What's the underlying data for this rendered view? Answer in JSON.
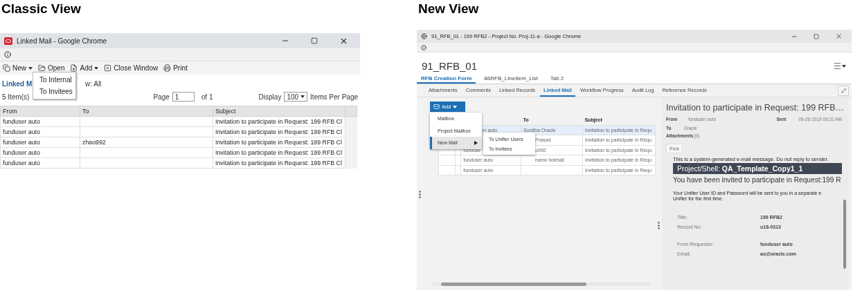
{
  "classic": {
    "heading": "Classic View",
    "window_title": "Linked Mail - Google Chrome",
    "toolbar": [
      {
        "label": "New",
        "kind": "new"
      },
      {
        "label": "Open",
        "kind": "open"
      },
      {
        "label": "Add",
        "kind": "add"
      },
      {
        "label": "Close Window",
        "kind": "close"
      },
      {
        "label": "Print",
        "kind": "print"
      }
    ],
    "new_menu": [
      "To Internal",
      "To Invitees"
    ],
    "breadcrumb": "Linked M",
    "view": "w: All",
    "count": "5 Item(s)",
    "page_label": "Page",
    "page_value": "1",
    "page_of": "of 1",
    "display_label": "Display",
    "display_value": "100",
    "per_page": "Items Per Page",
    "columns": [
      "From",
      "To",
      "Subject"
    ],
    "rows": [
      {
        "from": "funduser auto",
        "subject": "Invitation to participate in Request: 199 RFB Cl"
      },
      {
        "from": "funduser auto",
        "subject": "Invitation to participate in Request: 199 RFB Cl"
      },
      {
        "from": "funduser auto",
        "to": "zhao992",
        "subject": "Invitation to participate in Request: 199 RFB Cl"
      },
      {
        "from": "funduser auto",
        "subject": "Invitation to participate in Request: 199 RFB Cl"
      },
      {
        "from": "funduser auto",
        "subject": "Invitation to participate in Request: 199 RFB Cl"
      }
    ]
  },
  "modern": {
    "heading": "New View",
    "window_title": "91_RFB_01 - 199 RFB2 - Project No. Proj-11-a - Google Chrome",
    "record_title": "91_RFB_01",
    "tabs": [
      {
        "label": "RFB Creation Form",
        "selected": true
      },
      {
        "label": "86RFB_LIneItem_List",
        "selected": false
      },
      {
        "label": "Tab 2",
        "selected": false
      }
    ],
    "subtabs": [
      {
        "label": "Attachments",
        "selected": false
      },
      {
        "label": "Comments",
        "selected": false
      },
      {
        "label": "Linked Records",
        "selected": false
      },
      {
        "label": "Linked Mail",
        "selected": true
      },
      {
        "label": "Workflow Progress",
        "selected": false
      },
      {
        "label": "Audit Log",
        "selected": false
      },
      {
        "label": "Reference Records",
        "selected": false
      }
    ],
    "add_label": "Add",
    "add_menu": [
      {
        "label": "Mailbox",
        "selected": false,
        "kind": "item"
      },
      {
        "label": "Project Mailbox",
        "selected": false,
        "kind": "item"
      },
      {
        "label": "New Mail",
        "selected": true,
        "kind": "submenu"
      }
    ],
    "submenu": [
      "To Unifier Users",
      "To Invitees"
    ],
    "columns": [
      "To",
      "Subject"
    ],
    "rows": [
      {
        "from": "er auto",
        "to": "Sunitha Oracle",
        "subject": "Invitation to participate in Requ",
        "selected": true
      },
      {
        "to": "Prasad",
        "subject": "Invitation to participate in Requ",
        "selected": false
      },
      {
        "from": "funduse",
        "to": "o992",
        "subject": "Invitation to participate in Requ",
        "selected": false
      },
      {
        "from": "funduser auto",
        "to": "hamv hotmail",
        "subject": "Invitation to participate in Requ",
        "selected": false
      },
      {
        "from": "funduser auto",
        "subject": "Invitation to participate in Requ",
        "selected": false
      }
    ],
    "detail": {
      "title": "Invitation to participate in Request: 199 RFB…",
      "from_label": "From",
      "from": "funduser auto",
      "sent_label": "Sent",
      "sent": "09-26-2019 06:31 AM",
      "to_label": "To",
      "to": "Oracle",
      "attachments_label": "Attachments",
      "attachments_count": "(0)",
      "print": "Print",
      "notice": "This is a system-generated e-mail message. Do not reply to sender.",
      "banner": "Project/Shell: **QA_Template_Copy1_1**",
      "invite": "You have been invited to participate in Request:199 R",
      "info": [
        "Your Unifier User ID and Password will be sent to you in a separate e",
        "Unifier for the first time."
      ],
      "field_groups": [
        [
          {
            "label": "Title:",
            "value": "199 RFB2"
          },
          {
            "label": "Record No:",
            "value": "u18-0313"
          }
        ],
        [
          {
            "label": "From Requestor:",
            "value": "funduser auto"
          },
          {
            "label": "Email:",
            "value": "ao@oracle.com"
          }
        ]
      ]
    }
  }
}
